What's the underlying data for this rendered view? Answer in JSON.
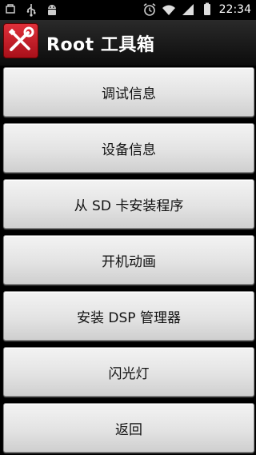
{
  "status_bar": {
    "time": "22:34",
    "left_icons": [
      "notification-icon",
      "usb-icon",
      "android-debug-icon"
    ],
    "right_icons": [
      "alarm-icon",
      "wifi-icon",
      "signal-icon",
      "battery-icon"
    ]
  },
  "title_bar": {
    "title": "Root 工具箱",
    "icon": "toolbox-icon"
  },
  "menu": {
    "items": [
      {
        "label": "调试信息"
      },
      {
        "label": "设备信息"
      },
      {
        "label": "从 SD 卡安装程序"
      },
      {
        "label": "开机动画"
      },
      {
        "label": "安装 DSP 管理器"
      },
      {
        "label": "闪光灯"
      },
      {
        "label": "返回"
      }
    ]
  },
  "colors": {
    "background": "#000000",
    "button_face": "#e3e3e3",
    "app_icon": "#c8202a"
  }
}
